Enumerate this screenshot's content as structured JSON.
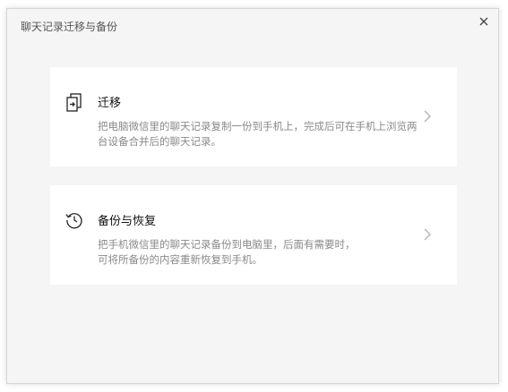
{
  "window": {
    "title": "聊天记录迁移与备份"
  },
  "options": [
    {
      "title": "迁移",
      "description": "把电脑微信里的聊天记录复制一份到手机上，完成后可在手机上浏览两台设备合并后的聊天记录。",
      "icon": "migrate-icon"
    },
    {
      "title": "备份与恢复",
      "description_line1": "把手机微信里的聊天记录备份到电脑里，后面有需要时，",
      "description_line2": "可将所备份的内容重新恢复到手机。",
      "icon": "history-icon"
    }
  ],
  "colors": {
    "background": "#f5f5f5",
    "card": "#ffffff",
    "title_text": "#111111",
    "desc_text": "#8a8a8a"
  }
}
